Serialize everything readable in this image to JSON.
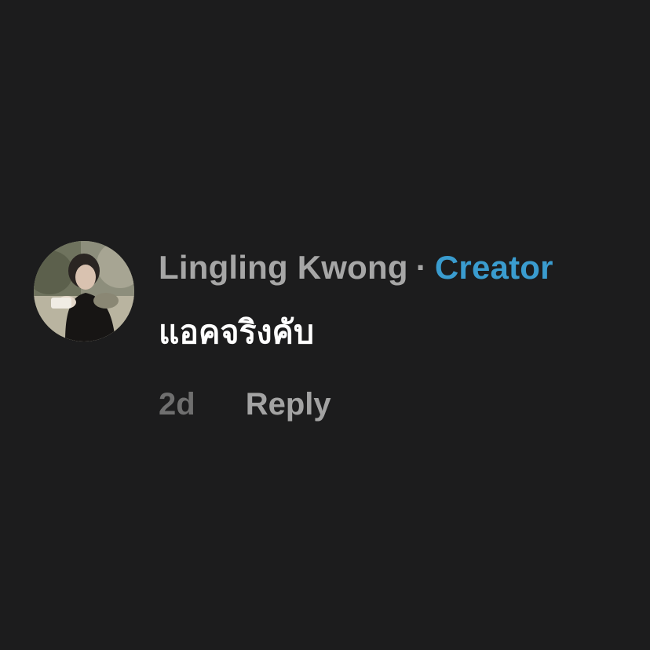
{
  "comment": {
    "author": "Lingling Kwong",
    "separator": "·",
    "badge": "Creator",
    "text": "แอคจริงคับ",
    "timestamp": "2d",
    "reply_label": "Reply"
  },
  "colors": {
    "background": "#1c1c1d",
    "author": "#a6a6a6",
    "creator": "#3a9ccf",
    "text": "#ffffff",
    "timestamp": "#6f6f6f",
    "reply": "#a3a3a3"
  },
  "icons": {
    "avatar": "profile-photo"
  }
}
